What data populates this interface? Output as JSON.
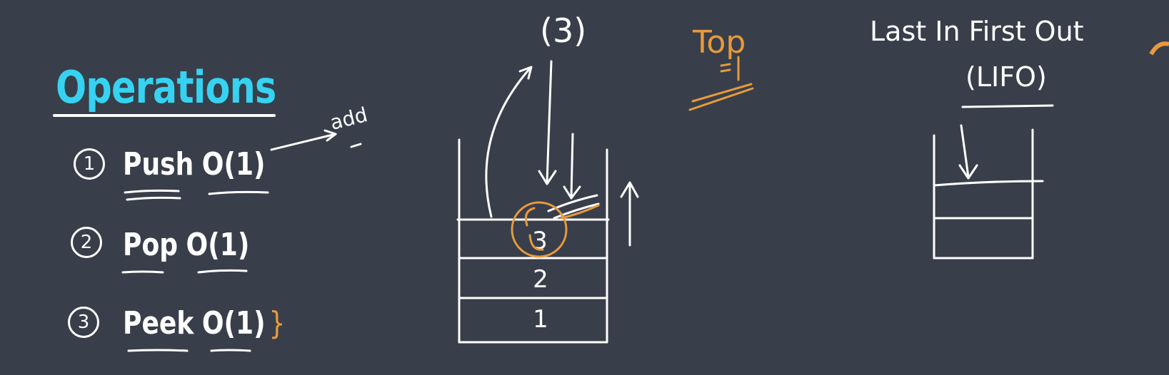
{
  "heading": "Operations",
  "operations": [
    {
      "index": "1",
      "name": "Push",
      "complexity": "O(1)",
      "annotation": "add"
    },
    {
      "index": "2",
      "name": "Pop",
      "complexity": "O(1)"
    },
    {
      "index": "3",
      "name": "Peek",
      "complexity": "O(1)",
      "brace": "}"
    }
  ],
  "stack": {
    "cells": [
      "3",
      "2",
      "1"
    ],
    "incoming_label": "(3)",
    "top_label": "Top"
  },
  "lifo": {
    "phrase": "Last In First Out",
    "acronym": "(LIFO)"
  },
  "colors": {
    "board": "#383f4a",
    "heading": "#35d3f1",
    "chalk": "#ffffff",
    "accent": "#e89a3c"
  }
}
